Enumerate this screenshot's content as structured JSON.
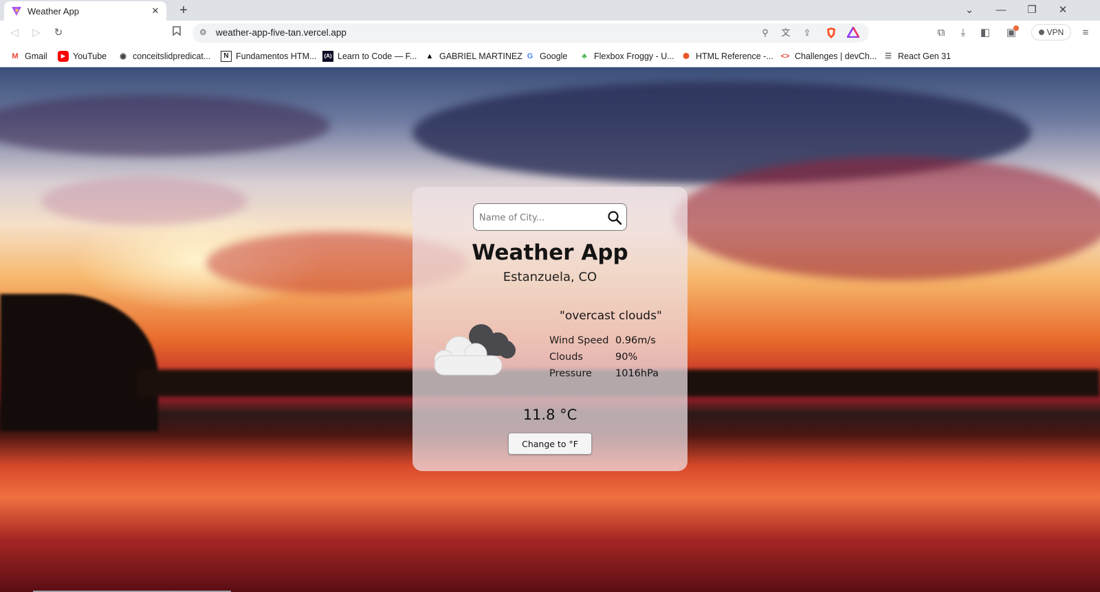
{
  "browser": {
    "tab": {
      "title": "Weather App"
    },
    "toolbar": {
      "url": "weather-app-five-tan.vercel.app",
      "vpn_label": "VPN"
    },
    "bookmarks": [
      {
        "label": "Gmail",
        "icon": "gmail-icon"
      },
      {
        "label": "YouTube",
        "icon": "youtube-icon"
      },
      {
        "label": "conceitslidpredicat...",
        "icon": "globe-icon"
      },
      {
        "label": "Fundamentos HTM...",
        "icon": "notion-icon"
      },
      {
        "label": "Learn to Code — F...",
        "icon": "freecodecamp-icon"
      },
      {
        "label": "GABRIEL MARTINEZ",
        "icon": "triangle-icon"
      },
      {
        "label": "Google",
        "icon": "google-icon"
      },
      {
        "label": "Flexbox Froggy - U...",
        "icon": "frog-icon"
      },
      {
        "label": "HTML Reference -...",
        "icon": "html-reference-icon"
      },
      {
        "label": "Challenges | devCh...",
        "icon": "devchallenges-icon"
      },
      {
        "label": "React Gen 31",
        "icon": "document-icon"
      }
    ]
  },
  "weather": {
    "search_placeholder": "Name of City...",
    "title": "Weather App",
    "location": "Estanzuela, CO",
    "description": "\"overcast clouds\"",
    "stats": [
      {
        "label": "Wind Speed",
        "value": "0.96m/s"
      },
      {
        "label": "Clouds",
        "value": "90%"
      },
      {
        "label": "Pressure",
        "value": "1016hPa"
      }
    ],
    "temperature": "11.8 °C",
    "unit_button": "Change to °F",
    "icon": "overcast-clouds-icon"
  },
  "colors": {
    "tab_strip": "#dee1e6",
    "card_bg": "rgba(238,226,232,0.72)",
    "title_text": "#141414"
  }
}
